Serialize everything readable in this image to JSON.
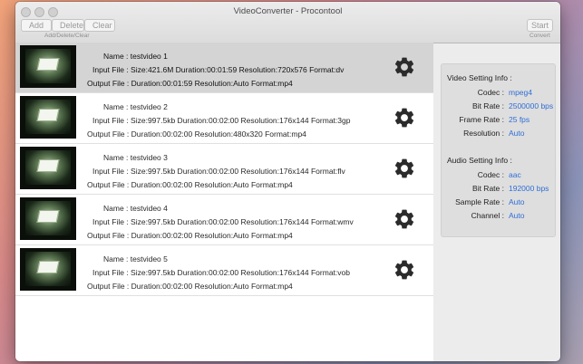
{
  "window": {
    "title": "VideoConverter - Procontool"
  },
  "toolbar": {
    "add_label": "Add",
    "delete_label": "Delete",
    "clear_label": "Clear",
    "group_caption": "Add/Delete/Clear",
    "start_label": "Start",
    "start_caption": "Convert"
  },
  "files": [
    {
      "name_line": "Name : testvideo 1",
      "input_line": "Input File : Size:421.6M  Duration:00:01:59  Resolution:720x576  Format:dv",
      "output_line": "Output File : Duration:00:01:59  Resolution:Auto  Format:mp4",
      "selected": true
    },
    {
      "name_line": "Name : testvideo 2",
      "input_line": "Input File : Size:997.5kb  Duration:00:02:00  Resolution:176x144  Format:3gp",
      "output_line": "Output File : Duration:00:02:00  Resolution:480x320  Format:mp4",
      "selected": false
    },
    {
      "name_line": "Name : testvideo 3",
      "input_line": "Input File : Size:997.5kb  Duration:00:02:00  Resolution:176x144  Format:flv",
      "output_line": "Output File : Duration:00:02:00  Resolution:Auto  Format:mp4",
      "selected": false
    },
    {
      "name_line": "Name : testvideo 4",
      "input_line": "Input File : Size:997.5kb  Duration:00:02:00  Resolution:176x144  Format:wmv",
      "output_line": "Output File : Duration:00:02:00  Resolution:Auto  Format:mp4",
      "selected": false
    },
    {
      "name_line": "Name : testvideo 5",
      "input_line": "Input File : Size:997.5kb  Duration:00:02:00  Resolution:176x144  Format:vob",
      "output_line": "Output File : Duration:00:02:00  Resolution:Auto  Format:mp4",
      "selected": false
    }
  ],
  "icons": {
    "thumbnail": "video-thumbnail",
    "settings": "gear-icon"
  },
  "settings": {
    "video_title": "Video Setting Info :",
    "video": [
      {
        "label": "Codec :",
        "value": "mpeg4"
      },
      {
        "label": "Bit Rate :",
        "value": "2500000 bps"
      },
      {
        "label": "Frame Rate :",
        "value": "25 fps"
      },
      {
        "label": "Resolution :",
        "value": "Auto"
      }
    ],
    "audio_title": "Audio Setting Info :",
    "audio": [
      {
        "label": "Codec :",
        "value": "aac"
      },
      {
        "label": "Bit Rate :",
        "value": "192000 bps"
      },
      {
        "label": "Sample Rate :",
        "value": "Auto"
      },
      {
        "label": "Channel :",
        "value": "Auto"
      }
    ]
  },
  "colors": {
    "link_value": "#2f6ed8",
    "selected_row": "#d4d4d4",
    "panel_bg": "#dedede"
  }
}
